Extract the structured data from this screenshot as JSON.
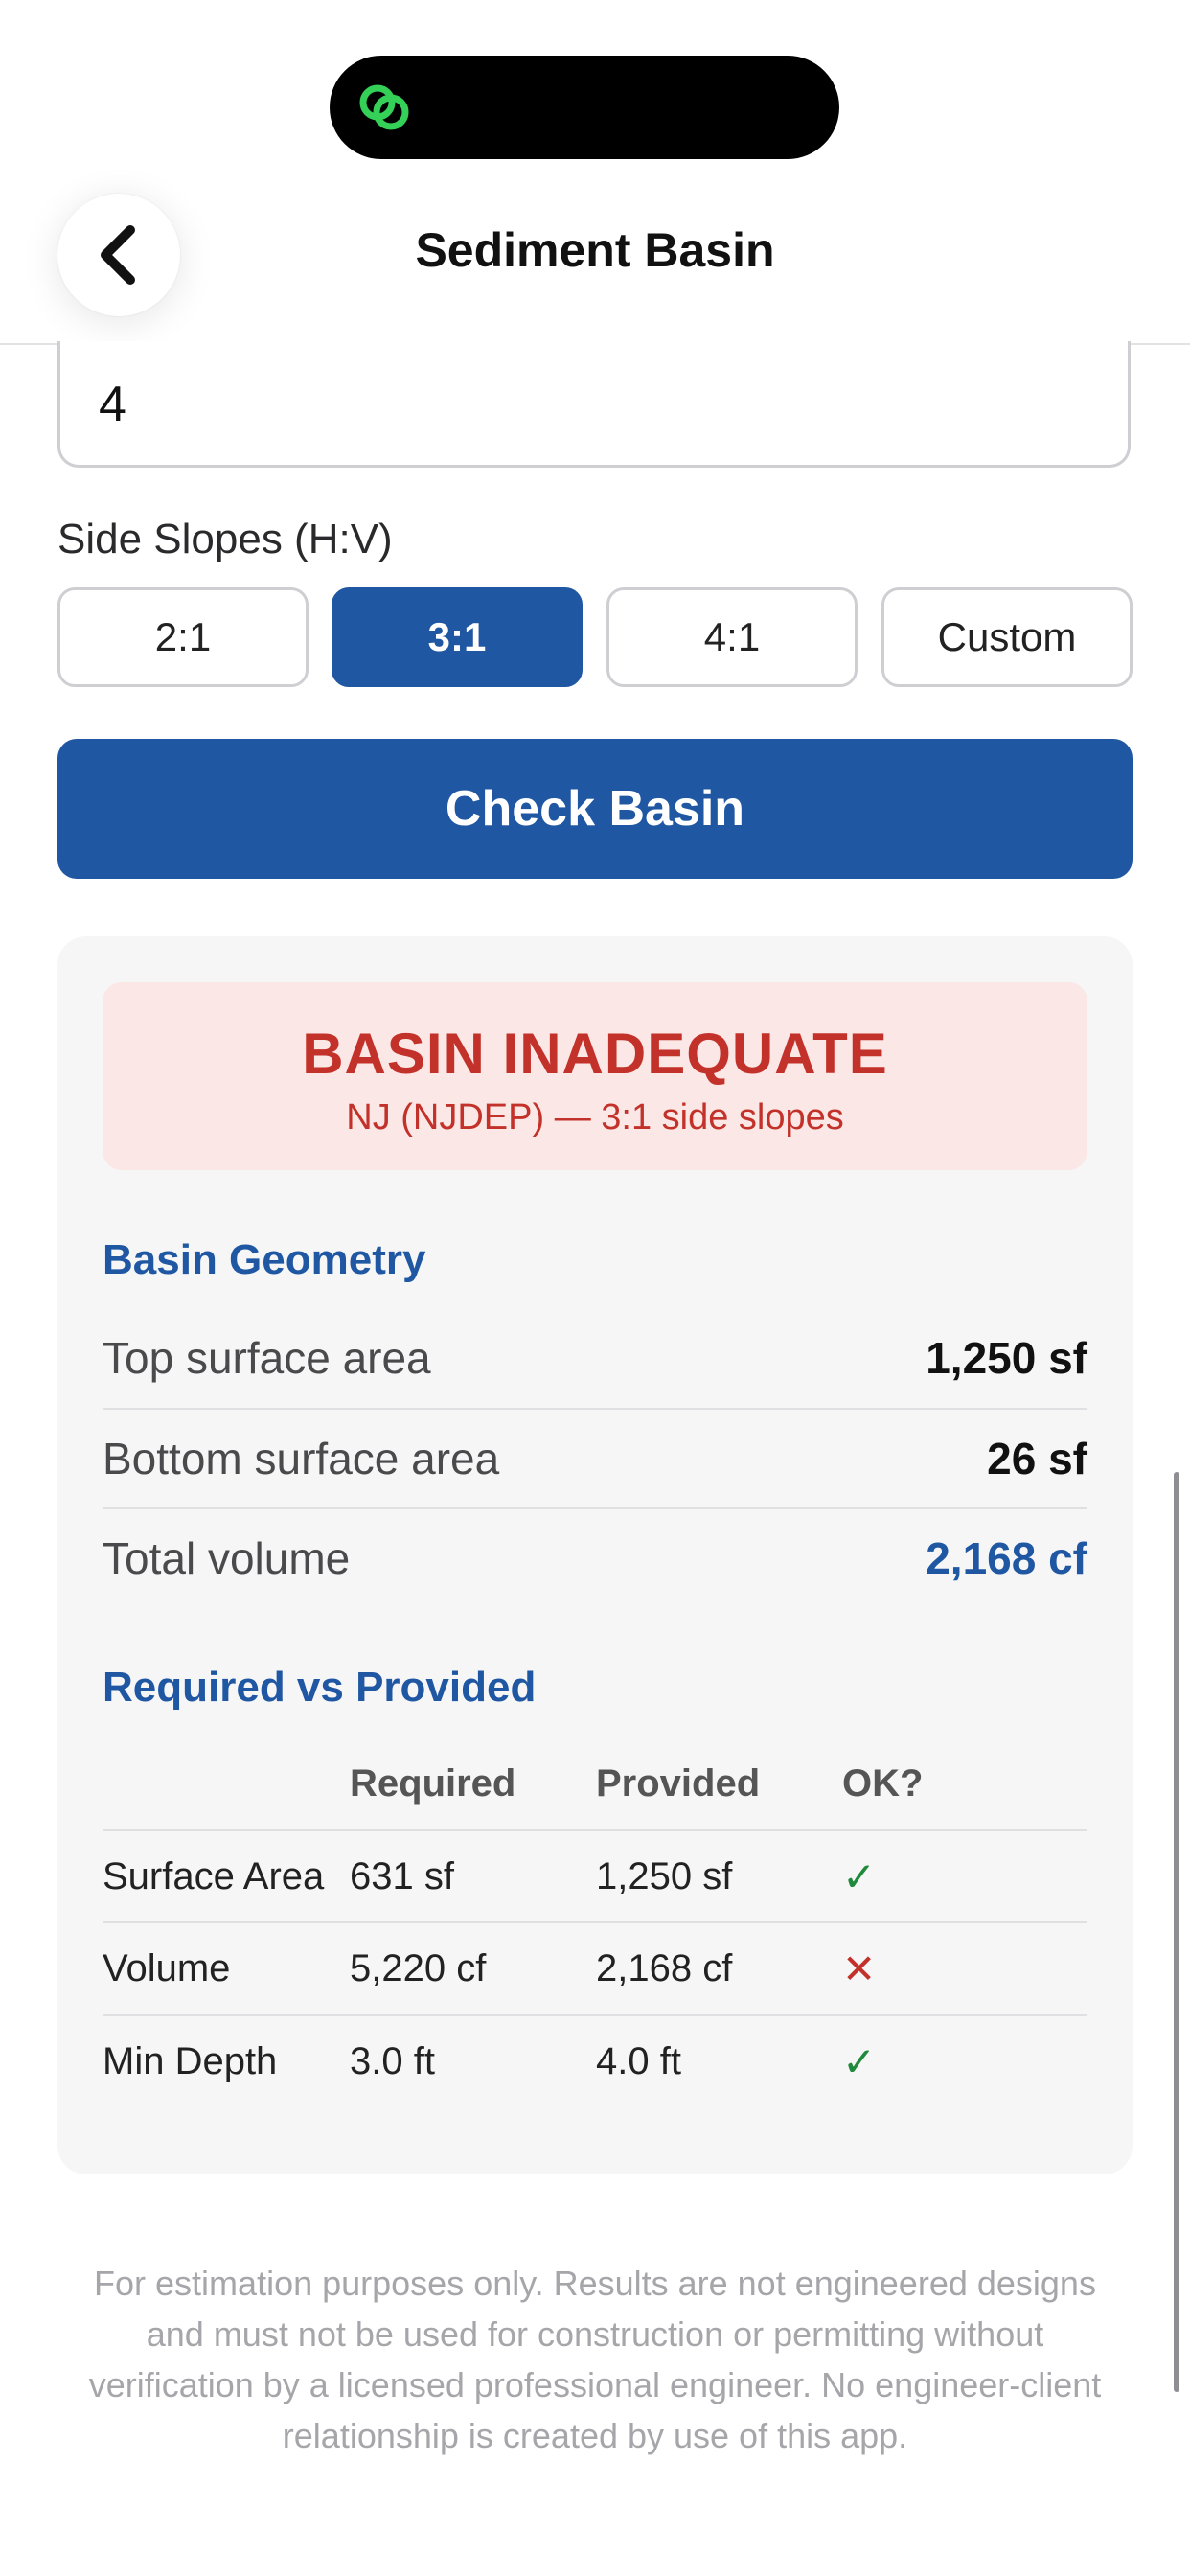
{
  "header": {
    "title": "Sediment Basin"
  },
  "form": {
    "depth_value": "4",
    "side_slopes_label": "Side Slopes (H:V)",
    "slope_options": [
      "2:1",
      "3:1",
      "4:1",
      "Custom"
    ],
    "selected_slope": "3:1",
    "submit_label": "Check Basin"
  },
  "result": {
    "status_title": "BASIN INADEQUATE",
    "status_subtitle": "NJ (NJDEP) — 3:1 side slopes",
    "geometry_heading": "Basin Geometry",
    "geometry": [
      {
        "label": "Top surface area",
        "value": "1,250 sf"
      },
      {
        "label": "Bottom surface area",
        "value": "26 sf"
      },
      {
        "label": "Total volume",
        "value": "2,168 cf"
      }
    ],
    "comparison_heading": "Required vs Provided",
    "comparison_columns": [
      "",
      "Required",
      "Provided",
      "OK?"
    ],
    "comparison_rows": [
      {
        "item": "Surface Area",
        "required": "631 sf",
        "provided": "1,250 sf",
        "ok": "✓"
      },
      {
        "item": "Volume",
        "required": "5,220 cf",
        "provided": "2,168 cf",
        "ok": "✕"
      },
      {
        "item": "Min Depth",
        "required": "3.0 ft",
        "provided": "4.0 ft",
        "ok": "✓"
      }
    ]
  },
  "disclaimer": "For estimation purposes only. Results are not engineered designs and must not be used for construction or permitting without verification by a licensed professional engineer. No engineer-client relationship is created by use of this app.",
  "colors": {
    "accent": "#1f57a3",
    "fail": "#c3322a",
    "pass": "#1f8a3b",
    "banner_bg": "#fbe7e5"
  },
  "icons": {
    "back": "chevron-left-icon",
    "island": "link-rings-icon",
    "pass": "checkmark-icon",
    "fail": "cross-icon"
  }
}
